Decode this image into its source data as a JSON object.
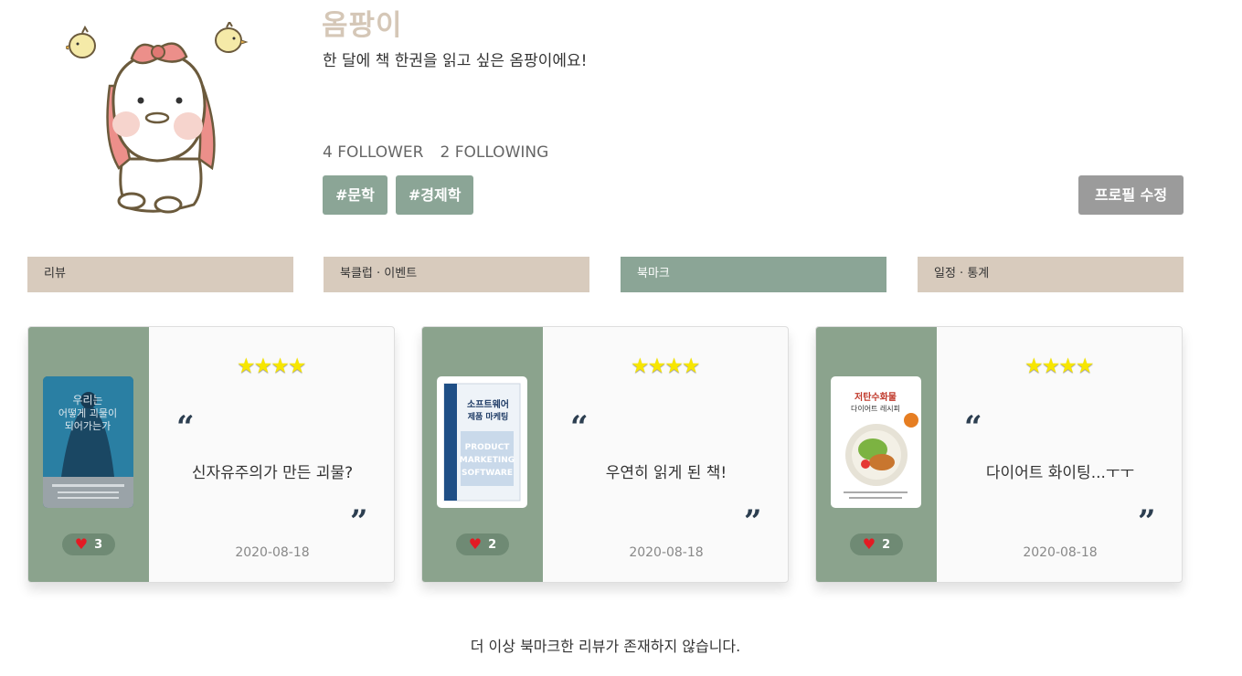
{
  "profile": {
    "name": "옴팡이",
    "intro": "한 달에 책 한권을 읽고 싶은 옴팡이에요!",
    "followers": "4 FOLLOWER",
    "following": "2 FOLLOWING",
    "tags": [
      "#문학",
      "#경제학"
    ],
    "edit_label": "프로필 수정"
  },
  "tabs": [
    {
      "label": "리뷰",
      "active": false
    },
    {
      "label": "북클럽 · 이벤트",
      "active": false
    },
    {
      "label": "북마크",
      "active": true
    },
    {
      "label": "일정 · 통계",
      "active": false
    }
  ],
  "cards": [
    {
      "rating": 4,
      "stars": "★★★★",
      "title": "신자유주의가 만든 괴물?",
      "date": "2020-08-18",
      "likes": "3",
      "cover_title": "우리는 어떻게 괴물이 되어가는가"
    },
    {
      "rating": 4,
      "stars": "★★★★",
      "title": "우연히 읽게 된 책!",
      "date": "2020-08-18",
      "likes": "2",
      "cover_title": "소프트웨어 제품 마케팅"
    },
    {
      "rating": 4,
      "stars": "★★★★",
      "title": "다이어트 화이팅...ㅜㅜ",
      "date": "2020-08-18",
      "likes": "2",
      "cover_title": "저탄수화물 다이어트 레시피"
    }
  ],
  "empty_message": "더 이상 북마크한 리뷰가 존재하지 않습니다.",
  "colors": {
    "accent_green": "#8ba596",
    "tab_beige": "#d8cbbd",
    "name_color": "#d5c7b7",
    "edit_button": "#9b9b9b",
    "heart": "#e31b23",
    "star": "#f7e600"
  }
}
